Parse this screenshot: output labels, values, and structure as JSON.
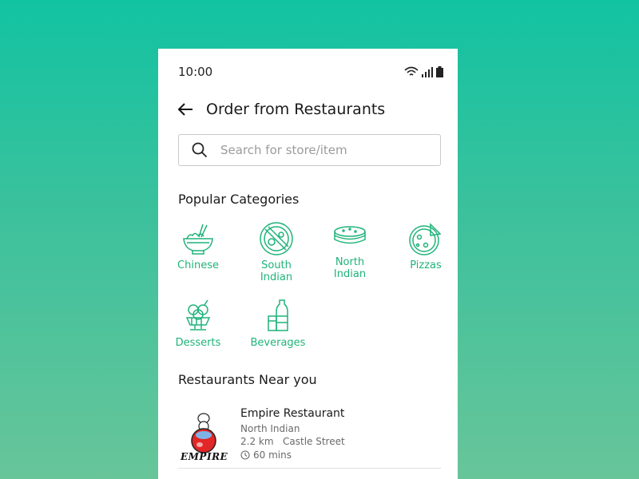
{
  "status_bar": {
    "time": "10:00"
  },
  "header": {
    "title": "Order from Restaurants"
  },
  "search": {
    "placeholder": "Search for store/item"
  },
  "popular": {
    "title": "Popular Categories",
    "categories": [
      {
        "label_lines": [
          "Chinese"
        ],
        "icon": "noodle-bowl-icon"
      },
      {
        "label_lines": [
          "South",
          "Indian"
        ],
        "icon": "dosa-plate-icon"
      },
      {
        "label_lines": [
          "North",
          "Indian"
        ],
        "icon": "roti-stack-icon"
      },
      {
        "label_lines": [
          "Pizzas"
        ],
        "icon": "pizza-icon"
      },
      {
        "label_lines": [
          "Desserts"
        ],
        "icon": "ice-cream-icon"
      },
      {
        "label_lines": [
          "Beverages"
        ],
        "icon": "bottle-icon"
      }
    ]
  },
  "nearby": {
    "title": "Restaurants Near you",
    "restaurants": [
      {
        "name": "Empire Restaurant",
        "cuisine": "North Indian",
        "distance": "2.2 km",
        "location": "Castle Street",
        "eta": "60 mins",
        "logo_text": "EMPIRE"
      }
    ]
  },
  "colors": {
    "accent": "#1fb37a",
    "background_top": "#12c3a2",
    "background_bottom": "#68c59a"
  }
}
